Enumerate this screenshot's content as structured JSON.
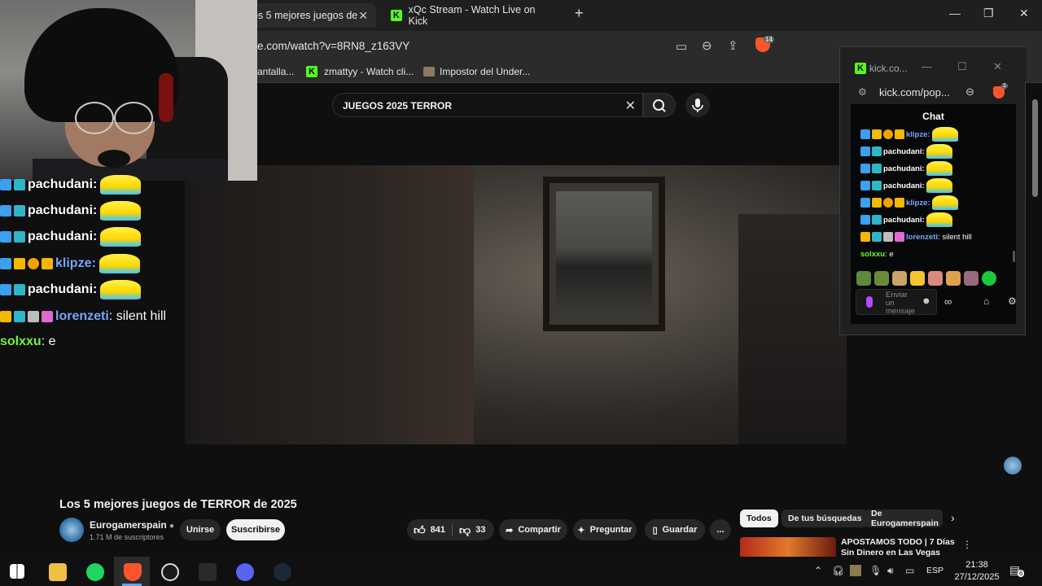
{
  "browser": {
    "tabs": [
      {
        "title": "os 5 mejores juegos de",
        "active": true
      },
      {
        "title": "xQc Stream - Watch Live on Kick",
        "active": false
      }
    ],
    "new_tab": "+",
    "url": "e.com/watch?v=8RN8_z163VY",
    "shield_count": "14",
    "bookmarks": [
      "antalla...",
      "zmattyy - Watch cli...",
      "Impostor del Under..."
    ]
  },
  "youtube": {
    "search_query": "JUEGOS 2025 TERROR",
    "video_title": "Los 5 mejores juegos de TERROR de 2025",
    "channel_name": "Eurogamerspain",
    "subscribers": "1.71 M de suscriptores",
    "join_label": "Unirse",
    "subscribe_label": "Suscribirse",
    "likes": "841",
    "dislikes": "33",
    "share_label": "Compartir",
    "ask_label": "Preguntar",
    "save_label": "Guardar",
    "more_label": "...",
    "chips": [
      "Todos",
      "De tus búsquedas",
      "De Eurogamerspain"
    ],
    "related_title": "APOSTAMOS TODO | 7 Días Sin Dinero en Las Vegas"
  },
  "overlay_chat": [
    {
      "user": "pachudani:",
      "text": ""
    },
    {
      "user": "pachudani:",
      "text": ""
    },
    {
      "user": "pachudani:",
      "text": ""
    },
    {
      "user": "klipze:",
      "text": ""
    },
    {
      "user": "pachudani:",
      "text": ""
    },
    {
      "user": "lorenzeti",
      "text": ": silent hill"
    },
    {
      "user": "solxxu",
      "text": ": e"
    }
  ],
  "kick_popup": {
    "window_title": "kick.co...",
    "url": "kick.com/pop...",
    "shield_count": "1",
    "chat_header": "Chat",
    "messages": [
      {
        "user": "klipze:",
        "text": ""
      },
      {
        "user": "pachudani:",
        "text": ""
      },
      {
        "user": "pachudani:",
        "text": ""
      },
      {
        "user": "pachudani:",
        "text": ""
      },
      {
        "user": "klipze:",
        "text": ""
      },
      {
        "user": "pachudani:",
        "text": ""
      },
      {
        "user": "lorenzeti",
        "text": ": silent hill"
      },
      {
        "user": "solxxu",
        "text": ": e"
      }
    ],
    "input_placeholder": "Enviar un mensaje"
  },
  "taskbar": {
    "language": "ESP",
    "time": "21:38",
    "date": "27/12/2025",
    "notifications": "6"
  },
  "colors": {
    "kick_green": "#53fc18",
    "youtube_bg": "#0f0f0f",
    "lorenzeti": "#7aa8ff",
    "solxxu": "#6dff2a",
    "brave_orange": "#fb542b"
  }
}
